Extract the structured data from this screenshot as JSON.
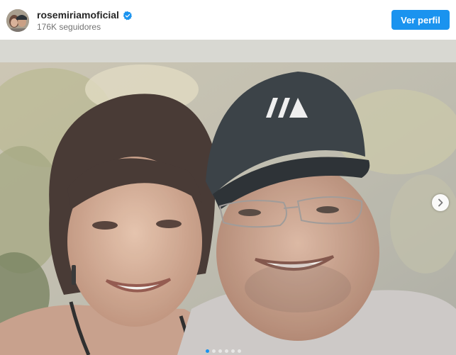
{
  "post_header": {
    "username": "rosemiriamoficial",
    "followers": "176K seguidores",
    "verified": true,
    "view_profile_label": "Ver perfil"
  },
  "icons": {
    "verified": "verified-badge-icon",
    "next": "chevron-right-icon"
  },
  "carousel": {
    "slide_count": 6,
    "active_index": 0
  },
  "colors": {
    "accent": "#1a93ef",
    "username_text": "#262626",
    "secondary_text": "#737373"
  }
}
